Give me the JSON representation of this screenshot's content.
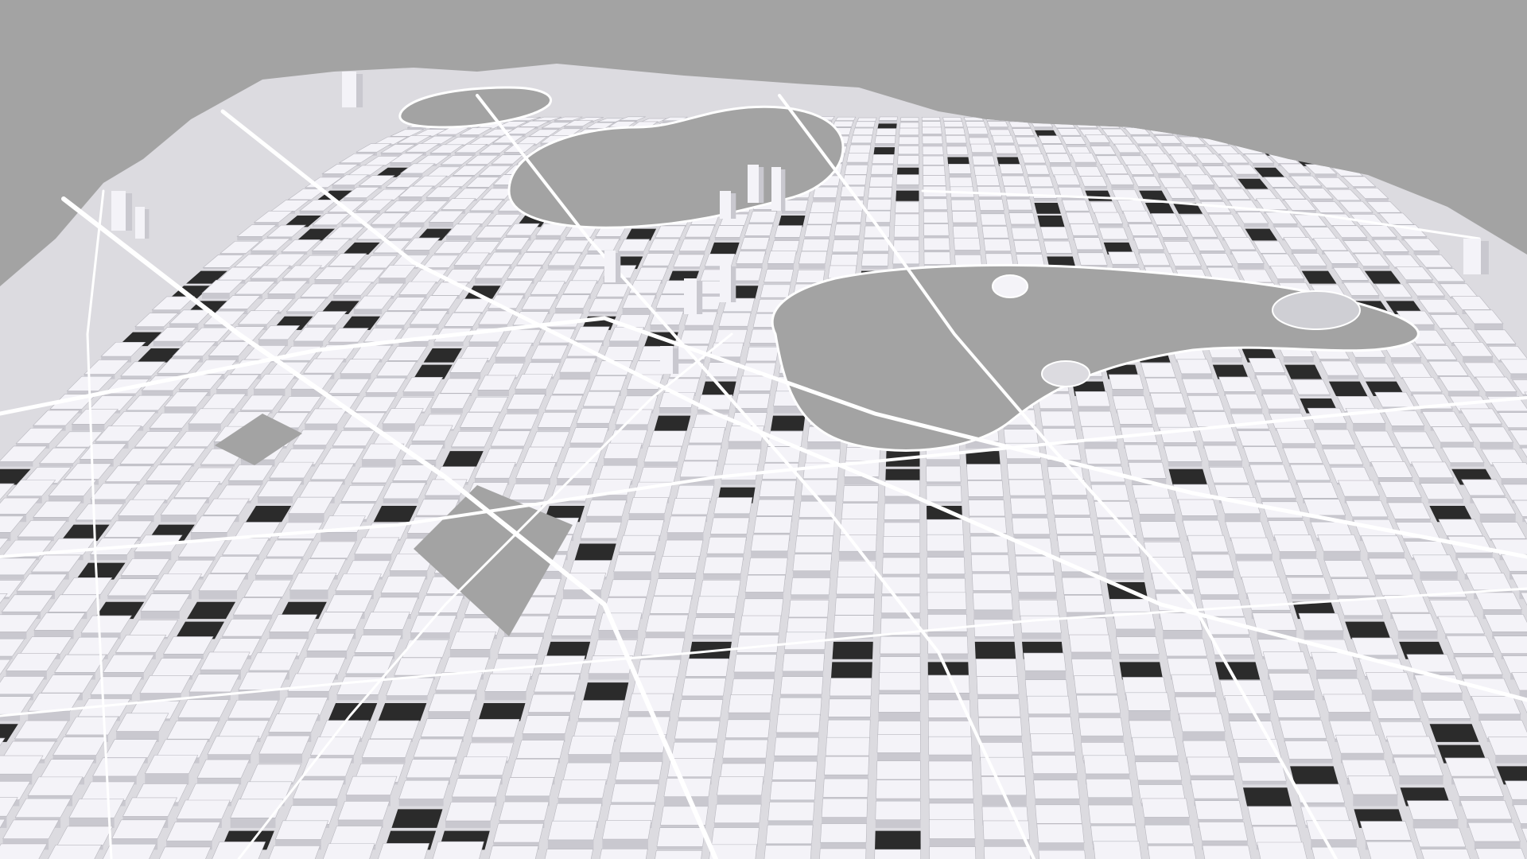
{
  "map": {
    "view": "3d-perspective-city-model",
    "labels": [],
    "colors": {
      "background": "#a3a3a3",
      "water": "#a3a3a3",
      "roads": "#ffffff",
      "building_top": "#f4f3f8",
      "building_side": "#c9c8cf",
      "shadow": "#2b2b2b"
    }
  }
}
